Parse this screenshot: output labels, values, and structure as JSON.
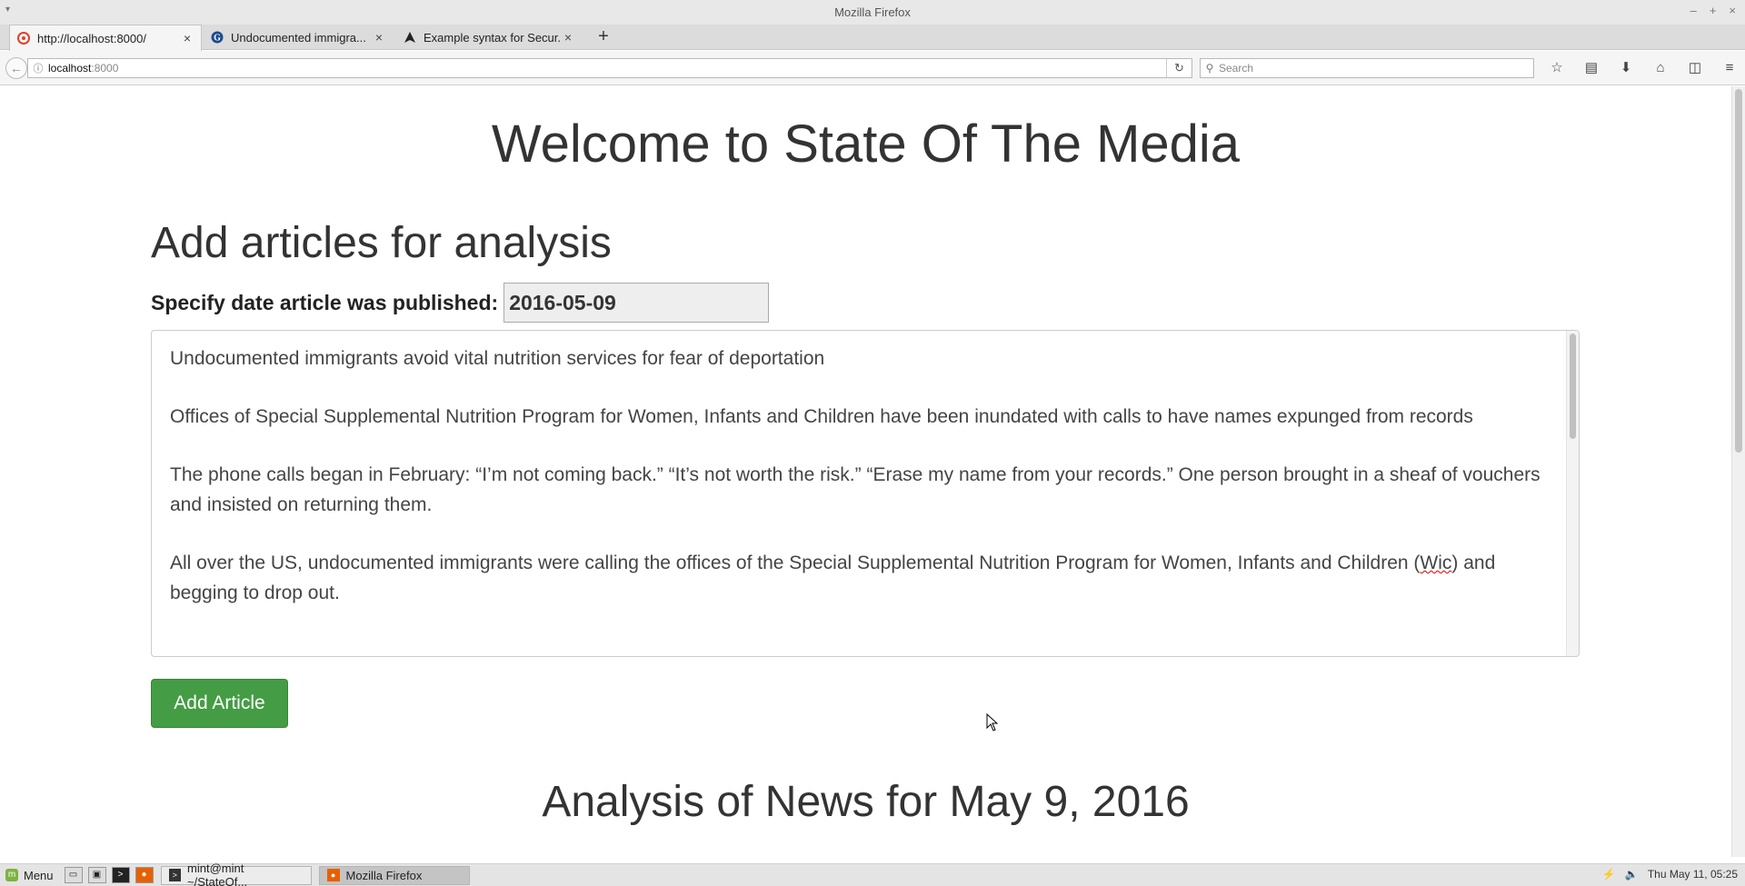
{
  "window": {
    "title": "Mozilla Firefox"
  },
  "tabs": [
    {
      "label": "http://localhost:8000/",
      "favicon": "red-app-icon",
      "active": true
    },
    {
      "label": "Undocumented immigra...",
      "favicon": "guardian-icon",
      "active": false
    },
    {
      "label": "Example syntax for Secur...",
      "favicon": "arch-icon",
      "active": false
    }
  ],
  "navbar": {
    "url_host": "localhost",
    "url_port": ":8000",
    "search_placeholder": "Search"
  },
  "page": {
    "welcome": "Welcome to State Of The Media",
    "section_title": "Add articles for analysis",
    "date_label": "Specify date article was published:",
    "date_value": "2016-05-09",
    "article_paragraphs": [
      "Undocumented immigrants avoid vital nutrition services for fear of deportation",
      "Offices of Special Supplemental Nutrition Program for Women, Infants and Children have been inundated with calls to have names expunged from records",
      "The phone calls began in February: “I’m not coming back.” “It’s not worth the risk.” “Erase my name from your records.” One person brought in a sheaf of vouchers and insisted on returning them.",
      "All over the US, undocumented immigrants were calling the offices of the Special Supplemental Nutrition Program for Women, Infants and Children ("
    ],
    "article_misspelled": "Wic",
    "article_tail": ") and begging to drop out.",
    "add_button": "Add Article",
    "analysis_title": "Analysis of News for May 9, 2016"
  },
  "taskbar": {
    "menu_label": "Menu",
    "tasks": [
      {
        "label": "mint@mint ~/StateOf...",
        "active": false
      },
      {
        "label": "Mozilla Firefox",
        "active": true
      }
    ],
    "clock": "Thu May 11, 05:25"
  },
  "colors": {
    "button_green": "#449d44",
    "text_dark": "#333333"
  }
}
